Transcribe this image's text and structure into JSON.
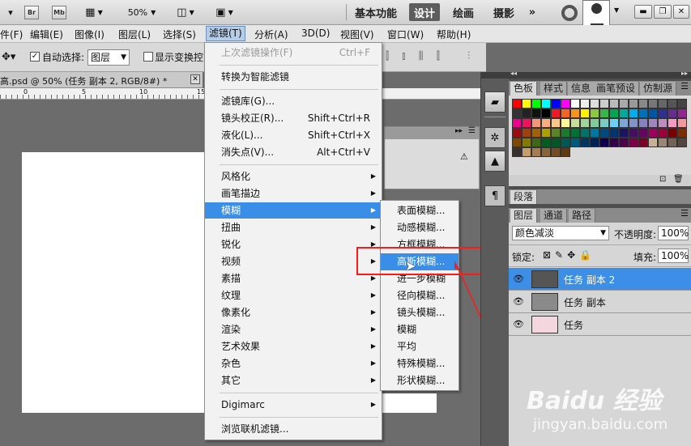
{
  "appbar": {
    "br": "Br",
    "mb": "Mb",
    "zoom": "50%",
    "workspaces": [
      "基本功能",
      "设计",
      "绘画",
      "摄影"
    ],
    "active_workspace": "设计",
    "more": "»"
  },
  "menubar": {
    "items": [
      "件(F)",
      "编辑(E)",
      "图像(I)",
      "图层(L)",
      "选择(S)",
      "滤镜(T)",
      "分析(A)",
      "3D(D)",
      "视图(V)",
      "窗口(W)",
      "帮助(H)"
    ],
    "active": "滤镜(T)"
  },
  "optbar": {
    "auto_select_label": "自动选择:",
    "auto_select_value": "图层",
    "show_transform_label": "显示变换控"
  },
  "doc": {
    "tab_title": "高.psd @ 50% (任务 副本 2, RGB/8#) *",
    "ruler_ticks": [
      "0",
      "5",
      "10",
      "15"
    ]
  },
  "filter_menu": {
    "items": [
      {
        "label": "上次滤镜操作(F)",
        "shortcut": "Ctrl+F",
        "disabled": true
      },
      {
        "sep": true
      },
      {
        "label": "转换为智能滤镜"
      },
      {
        "sep": true
      },
      {
        "label": "滤镜库(G)..."
      },
      {
        "label": "镜头校正(R)...",
        "shortcut": "Shift+Ctrl+R"
      },
      {
        "label": "液化(L)...",
        "shortcut": "Shift+Ctrl+X"
      },
      {
        "label": "消失点(V)...",
        "shortcut": "Alt+Ctrl+V"
      },
      {
        "sep": true
      },
      {
        "label": "风格化",
        "sub": true
      },
      {
        "label": "画笔描边",
        "sub": true
      },
      {
        "label": "模糊",
        "sub": true,
        "highlighted": true
      },
      {
        "label": "扭曲",
        "sub": true
      },
      {
        "label": "锐化",
        "sub": true
      },
      {
        "label": "视频",
        "sub": true
      },
      {
        "label": "素描",
        "sub": true
      },
      {
        "label": "纹理",
        "sub": true
      },
      {
        "label": "像素化",
        "sub": true
      },
      {
        "label": "渲染",
        "sub": true
      },
      {
        "label": "艺术效果",
        "sub": true
      },
      {
        "label": "杂色",
        "sub": true
      },
      {
        "label": "其它",
        "sub": true
      },
      {
        "sep": true
      },
      {
        "label": "Digimarc",
        "sub": true
      },
      {
        "sep": true
      },
      {
        "label": "浏览联机滤镜..."
      }
    ]
  },
  "blur_menu": {
    "items": [
      "表面模糊...",
      "动感模糊...",
      "方框模糊...",
      "高斯模糊...",
      "进一步模糊",
      "径向模糊...",
      "镜头模糊...",
      "模糊",
      "平均",
      "特殊模糊...",
      "形状模糊..."
    ],
    "highlighted": "高斯模糊..."
  },
  "swatches_panel": {
    "tabs": [
      "色板",
      "样式",
      "信息",
      "画笔预设",
      "仿制源"
    ],
    "palette": [
      "#ff0000",
      "#ffff00",
      "#00ff00",
      "#00ffff",
      "#0000ff",
      "#ff00ff",
      "#ffffff",
      "#eeeeee",
      "#dddddd",
      "#cccccc",
      "#bbbbbb",
      "#aaaaaa",
      "#999999",
      "#888888",
      "#777777",
      "#666666",
      "#555555",
      "#444444",
      "#333333",
      "#222222",
      "#111111",
      "#000000",
      "#ed1c24",
      "#f26522",
      "#f7941d",
      "#fff200",
      "#8dc63f",
      "#39b54a",
      "#00a651",
      "#00a99d",
      "#00aeef",
      "#0072bc",
      "#0054a6",
      "#2e3192",
      "#662d91",
      "#92278f",
      "#ec008c",
      "#ed145b",
      "#f69679",
      "#f9ad81",
      "#fdc689",
      "#fff79a",
      "#c4df9b",
      "#a3d39c",
      "#82ca9c",
      "#7accc8",
      "#6dcff6",
      "#7da7d9",
      "#8393ca",
      "#8781bd",
      "#a186be",
      "#bd8cbf",
      "#f49ac1",
      "#f5989d",
      "#9e0b0f",
      "#a0410d",
      "#a36209",
      "#aba000",
      "#598527",
      "#197b30",
      "#007236",
      "#00746b",
      "#0076a3",
      "#004a80",
      "#003471",
      "#1b1464",
      "#440e62",
      "#630460",
      "#9e005d",
      "#9e0039",
      "#790000",
      "#7b2e00",
      "#7d4900",
      "#827b00",
      "#406618",
      "#005e20",
      "#005826",
      "#005952",
      "#005b7f",
      "#003663",
      "#002157",
      "#0d004c",
      "#32004b",
      "#4b0049",
      "#7b0046",
      "#7a0026",
      "#c7b299",
      "#998675",
      "#736357",
      "#534741",
      "#37302d",
      "#c69c6d",
      "#a67c52",
      "#8c6239",
      "#754c24",
      "#603913"
    ]
  },
  "paragraph_tab": "段落",
  "layers_panel": {
    "tabs": [
      "图层",
      "通道",
      "路径"
    ],
    "blend_mode": "颜色减淡",
    "opacity_label": "不透明度:",
    "opacity_value": "100%",
    "lock_label": "锁定:",
    "fill_label": "填充:",
    "fill_value": "100%",
    "layers": [
      {
        "name": "任务 副本 2",
        "selected": true
      },
      {
        "name": "任务 副本",
        "selected": false
      },
      {
        "name": "任务",
        "selected": false
      }
    ]
  },
  "watermark": {
    "brand": "Baidu 经验",
    "url": "jingyan.baidu.com"
  },
  "colors": {
    "highlight": "#3a8ee8",
    "annotation": "#ff1a1a",
    "selected_layer": "#3d8ee6"
  }
}
